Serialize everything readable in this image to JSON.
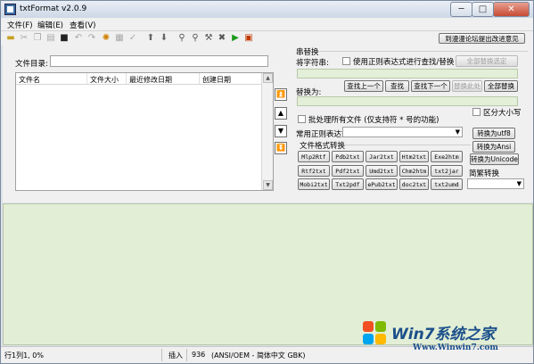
{
  "window": {
    "title": "txtFormat v2.0.9",
    "controls": {
      "minimize": "─",
      "maximize": "□",
      "close": "✕"
    }
  },
  "menu": [
    "文件(F)",
    "编辑(E)",
    "查看(V)"
  ],
  "toolbar_icons": [
    "open-folder-icon",
    "cut-icon",
    "copy-icon",
    "paste-icon",
    "save-icon",
    "undo-icon",
    "redo-icon",
    "settings-icon",
    "select-icon",
    "check-icon",
    "upload-icon",
    "download-icon",
    "search-icon",
    "search-replace-icon",
    "wrench-icon",
    "cross-tool-icon",
    "run-icon",
    "stop-icon"
  ],
  "header_link": "到漫漫论坛提出改进意见",
  "left": {
    "dir_label": "文件目录:",
    "dir_value": "",
    "columns": [
      "文件名",
      "文件大小",
      "最近修改日期",
      "创建日期"
    ],
    "nav": [
      "top",
      "up",
      "down",
      "bottom"
    ]
  },
  "replace": {
    "group_title": "串替换",
    "search_label": "将字符串:",
    "use_regex": "使用正则表达式进行查找/替换",
    "replace_all_selected": "全部替换选定",
    "prev": "查找上一个",
    "find": "查找",
    "next": "查找下一个",
    "replace_this": "替换此处",
    "replace_all": "全部替换",
    "replace_label": "替换为:",
    "match_case": "区分大小写",
    "batch": "批处理所有文件 (仅支持符 * 号的功能)",
    "regex_label": "常用正则表达式",
    "regex_value": ""
  },
  "convert": {
    "group_title": "文件格式转换",
    "buttons": [
      [
        "Mlp2Rtf",
        "Pdb2txt",
        "Jar2txt",
        "Htm2txt",
        "Exe2htm"
      ],
      [
        "Rtf2txt",
        "Pdf2txt",
        "Umd2txt",
        "Chm2htm",
        "txt2jar"
      ],
      [
        "Mobi2txt",
        "Txt2pdf",
        "ePub2txt",
        "doc2txt",
        "txt2umd"
      ]
    ],
    "to_utf8": "转换为utf8",
    "to_ansi": "转换为Ansi",
    "to_unicode": "转换为Unicode",
    "simp_trad_label": "简繁转换",
    "simp_trad_value": ""
  },
  "status": {
    "position": "行1列1, 0%",
    "mode": "插入",
    "count": "936",
    "encoding": "(ANSI/OEM - 简体中文 GBK)"
  },
  "watermark": {
    "title": "Win7系统之家",
    "url": "Www.Winwin7.com"
  }
}
